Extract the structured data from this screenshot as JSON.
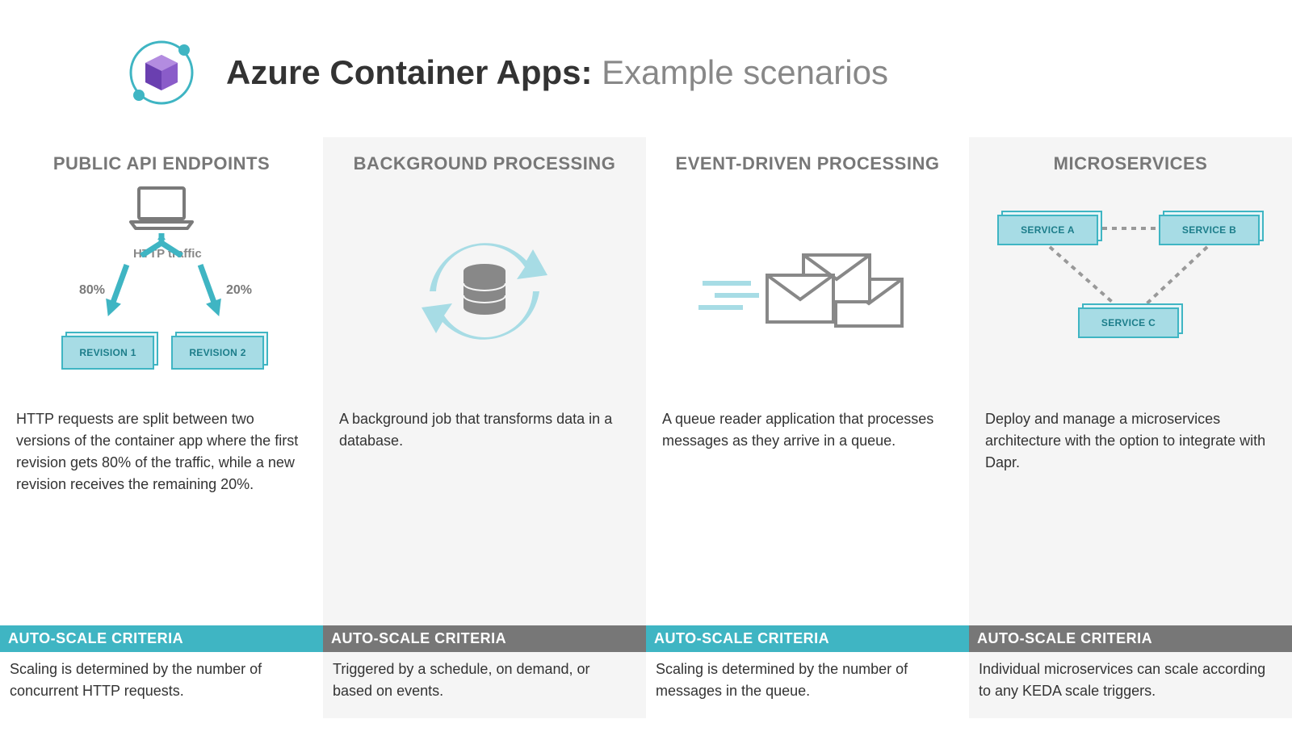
{
  "header": {
    "title_bold": "Azure Container Apps:",
    "title_light": "Example scenarios"
  },
  "columns": [
    {
      "heading": "PUBLIC API ENDPOINTS",
      "http_label": "HTTP traffic",
      "pct_left": "80%",
      "pct_right": "20%",
      "rev1": "REVISION 1",
      "rev2": "REVISION 2",
      "desc": "HTTP requests are split between two versions of the container app where the first revision gets 80% of the traffic, while a new revision receives the remaining 20%.",
      "scale_label": "AUTO-SCALE CRITERIA",
      "scale_text": "Scaling is determined by the number of concurrent HTTP requests."
    },
    {
      "heading": "BACKGROUND PROCESSING",
      "desc": "A background job that transforms data in a database.",
      "scale_label": "AUTO-SCALE CRITERIA",
      "scale_text": "Triggered by a schedule, on demand, or based on events."
    },
    {
      "heading": "EVENT-DRIVEN PROCESSING",
      "desc": "A queue reader application that processes messages as they arrive in a queue.",
      "scale_label": "AUTO-SCALE CRITERIA",
      "scale_text": "Scaling is determined by the number of messages in the queue."
    },
    {
      "heading": "MICROSERVICES",
      "svc_a": "SERVICE A",
      "svc_b": "SERVICE B",
      "svc_c": "SERVICE C",
      "desc": "Deploy and manage a microservices architecture with the option to integrate with Dapr.",
      "scale_label": "AUTO-SCALE CRITERIA",
      "scale_text": "Individual microservices can scale according to any KEDA scale triggers."
    }
  ]
}
